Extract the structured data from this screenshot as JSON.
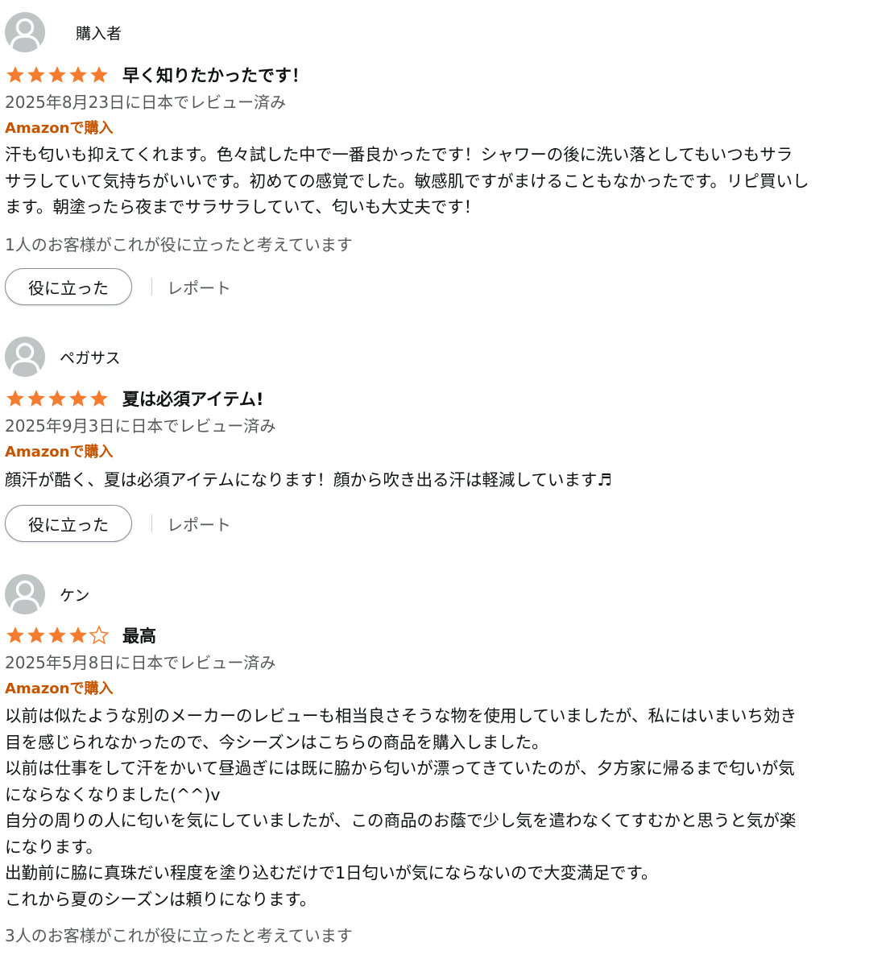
{
  "colors": {
    "star": "#f47c2f",
    "verified": "#c45500",
    "muted": "#565959"
  },
  "reviews": [
    {
      "reviewer": "購入者",
      "rating": 5,
      "title": "早く知りたかったです！",
      "date": "2025年8月23日に日本でレビュー済み",
      "verified": "Amazonで購入",
      "body": [
        "汗も匂いも抑えてくれます。色々試した中で一番良かったです！シャワーの後に洗い落としてもいつもサラ",
        "サラしていて気持ちがいいです。初めての感覚でした。敏感肌ですがまけることもなかったです。リピ買いし",
        "ます。朝塗ったら夜までサラサラしていて、匂いも大丈夫です！"
      ],
      "helpful_count": "1人のお客様がこれが役に立ったと考えています",
      "helpful_button": "役に立った",
      "report_link": "レポート"
    },
    {
      "reviewer": "ペガサス",
      "rating": 5,
      "title": "夏は必須アイテム!",
      "date": "2025年9月3日に日本でレビュー済み",
      "verified": "Amazonで購入",
      "body": [
        "顔汗が酷く、夏は必須アイテムになります！顔から吹き出る汗は軽減しています♬"
      ],
      "helpful_button": "役に立った",
      "report_link": "レポート"
    },
    {
      "reviewer": "ケン",
      "rating": 4,
      "title": "最高",
      "date": "2025年5月8日に日本でレビュー済み",
      "verified": "Amazonで購入",
      "body": [
        "以前は似たような別のメーカーのレビューも相当良さそうな物を使用していましたが、私にはいまいち効き",
        "目を感じられなかったので、今シーズンはこちらの商品を購入しました。",
        "以前は仕事をして汗をかいて昼過ぎには既に脇から匂いが漂ってきていたのが、夕方家に帰るまで匂いが気",
        "にならなくなりました(^^)v",
        "自分の周りの人に匂いを気にしていましたが、この商品のお蔭で少し気を遣わなくてすむかと思うと気が楽",
        "になります。",
        "出勤前に脇に真珠だい程度を塗り込むだけで1日匂いが気にならないので大変満足です。",
        "これから夏のシーズンは頼りになります。"
      ],
      "helpful_count": "3人のお客様がこれが役に立ったと考えています"
    }
  ]
}
